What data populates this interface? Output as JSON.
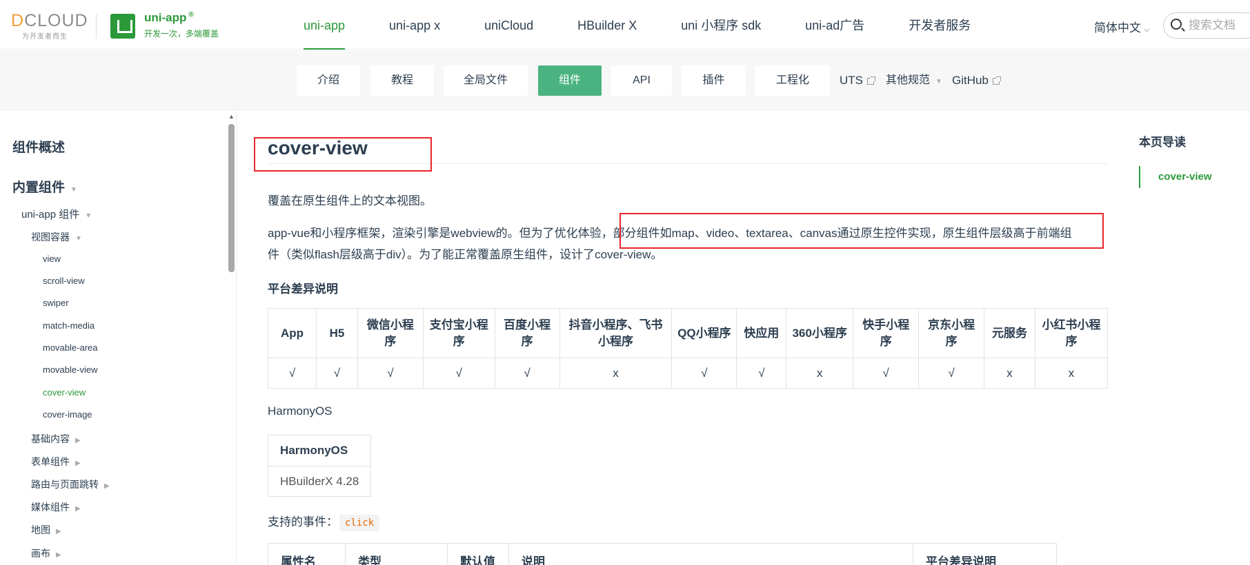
{
  "brand": {
    "dcloud_prefix": "D",
    "dcloud_rest": "CLOUD",
    "dcloud_slogan": "为开发者而生",
    "product_title": "uni-app",
    "product_reg": "®",
    "product_slogan": "开发一次，多端覆盖"
  },
  "mainnav": [
    "uni-app",
    "uni-app x",
    "uniCloud",
    "HBuilder X",
    "uni 小程序 sdk",
    "uni-ad广告",
    "开发者服务"
  ],
  "header": {
    "language": "简体中文",
    "search_placeholder": "搜索文档"
  },
  "subnav": {
    "pills": [
      "介绍",
      "教程",
      "全局文件",
      "组件",
      "API",
      "插件",
      "工程化"
    ],
    "links": [
      "UTS",
      "其他规范",
      "GitHub"
    ]
  },
  "sidebar": {
    "overview": "组件概述",
    "builtin": "内置组件",
    "uniapp_components": "uni-app 组件",
    "view_container": "视图容器",
    "view_items": [
      "view",
      "scroll-view",
      "swiper",
      "match-media",
      "movable-area",
      "movable-view",
      "cover-view",
      "cover-image"
    ],
    "categories": [
      "基础内容",
      "表单组件",
      "路由与页面跳转",
      "媒体组件",
      "地图",
      "画布"
    ]
  },
  "content": {
    "title": "cover-view",
    "intro": "覆盖在原生组件上的文本视图。",
    "para_part1": "app-vue和小程序框架，渲染引擎是webview的。但为了优化体验，部分组件如map、video、textarea、canvas通过原生控件实现，原生组件层级高于前端组",
    "para_part2": "件（类似flash层级高于div）。为了能正常覆盖原生组件，设计了cover-view。",
    "platform_heading": "平台差异说明",
    "platform_table": {
      "headers": [
        "App",
        "H5",
        "微信小程序",
        "支付宝小程序",
        "百度小程序",
        "抖音小程序、飞书小程序",
        "QQ小程序",
        "快应用",
        "360小程序",
        "快手小程序",
        "京东小程序",
        "元服务",
        "小红书小程序"
      ],
      "values": [
        "√",
        "√",
        "√",
        "√",
        "√",
        "x",
        "√",
        "√",
        "x",
        "√",
        "√",
        "x",
        "x"
      ]
    },
    "harmony_label": "HarmonyOS",
    "harmony_table": {
      "header": "HarmonyOS",
      "value": "HBuilderX 4.28"
    },
    "events_label": "支持的事件：",
    "events_code": "click",
    "props_headers": [
      "属性名",
      "类型",
      "默认值",
      "说明",
      "平台差异说明"
    ]
  },
  "toc": {
    "title": "本页导读",
    "items": [
      "cover-view"
    ]
  },
  "colors": {
    "brand_green": "#2b9939",
    "active_pill": "#4ab380",
    "highlight_box": "#e8242a"
  }
}
